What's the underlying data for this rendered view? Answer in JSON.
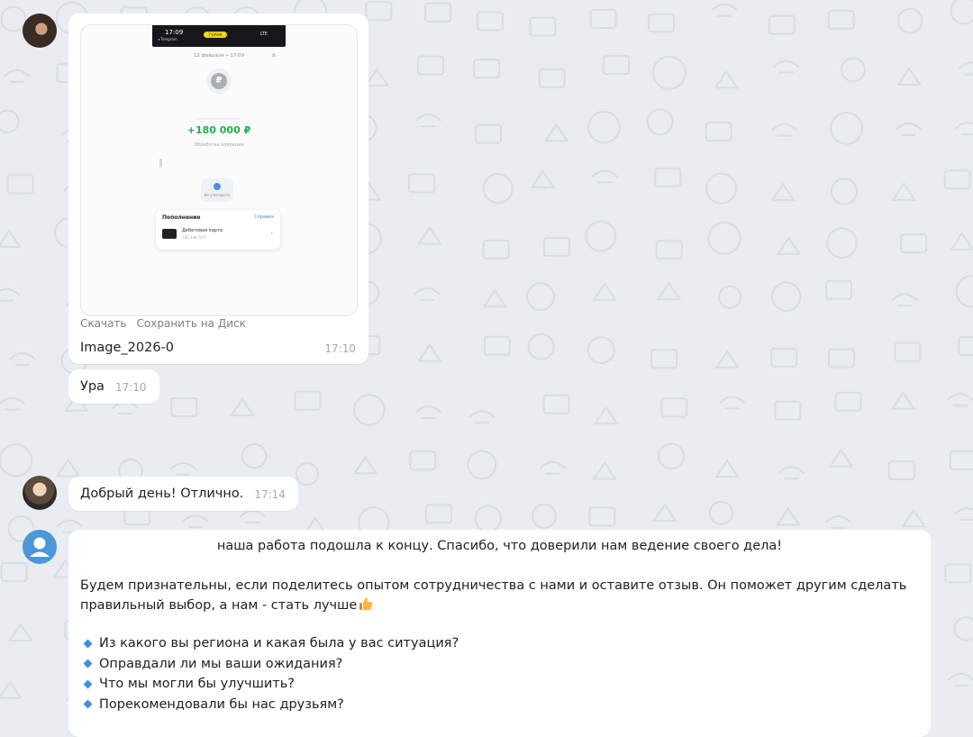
{
  "chat": {
    "colors": {
      "background": "#e9edf1",
      "bubble": "#ffffff",
      "accent": "#3d8fe0",
      "amount": "#20b04f"
    },
    "image_message": {
      "preview": {
        "status_time": "17:09",
        "status_pill": "Т‑БАНК",
        "status_network": "LTE",
        "status_sub": "◂ Telegram",
        "date": "12 февраля • 17:09",
        "currency_icon": "rouble-icon",
        "amount": "+180 000 ₽",
        "status": "Обработка операции",
        "action_label": "Не учитывать",
        "card_title": "Пополнение",
        "card_link": "Справка",
        "card_name": "Дебетовая карта",
        "card_sub": "182 336,78 ₽"
      },
      "download_label": "Скачать",
      "save_label": "Сохранить на Диск",
      "file_name": "Image_2026-0",
      "time": "17:10"
    },
    "messages": [
      {
        "text": "Ура",
        "time": "17:10"
      },
      {
        "text": "Добрый день! Отлично.",
        "time": "17:14"
      }
    ],
    "long_message": {
      "first_line": "наша работа подошла к концу. Спасибо, что доверили нам ведение своего дела!",
      "paragraph": "Будем признательны, если поделитесь опытом сотрудничества с нами и оставите отзыв. Он поможет другим сделать правильный выбор, а нам - стать лучше",
      "emoji": "thumbs-up-icon",
      "questions": [
        "Из какого вы региона и какая была у вас ситуация?",
        "Оправдали ли мы ваши ожидания?",
        "Что мы могли бы улучшить?",
        "Порекомендовали бы нас друзьям?"
      ]
    }
  }
}
